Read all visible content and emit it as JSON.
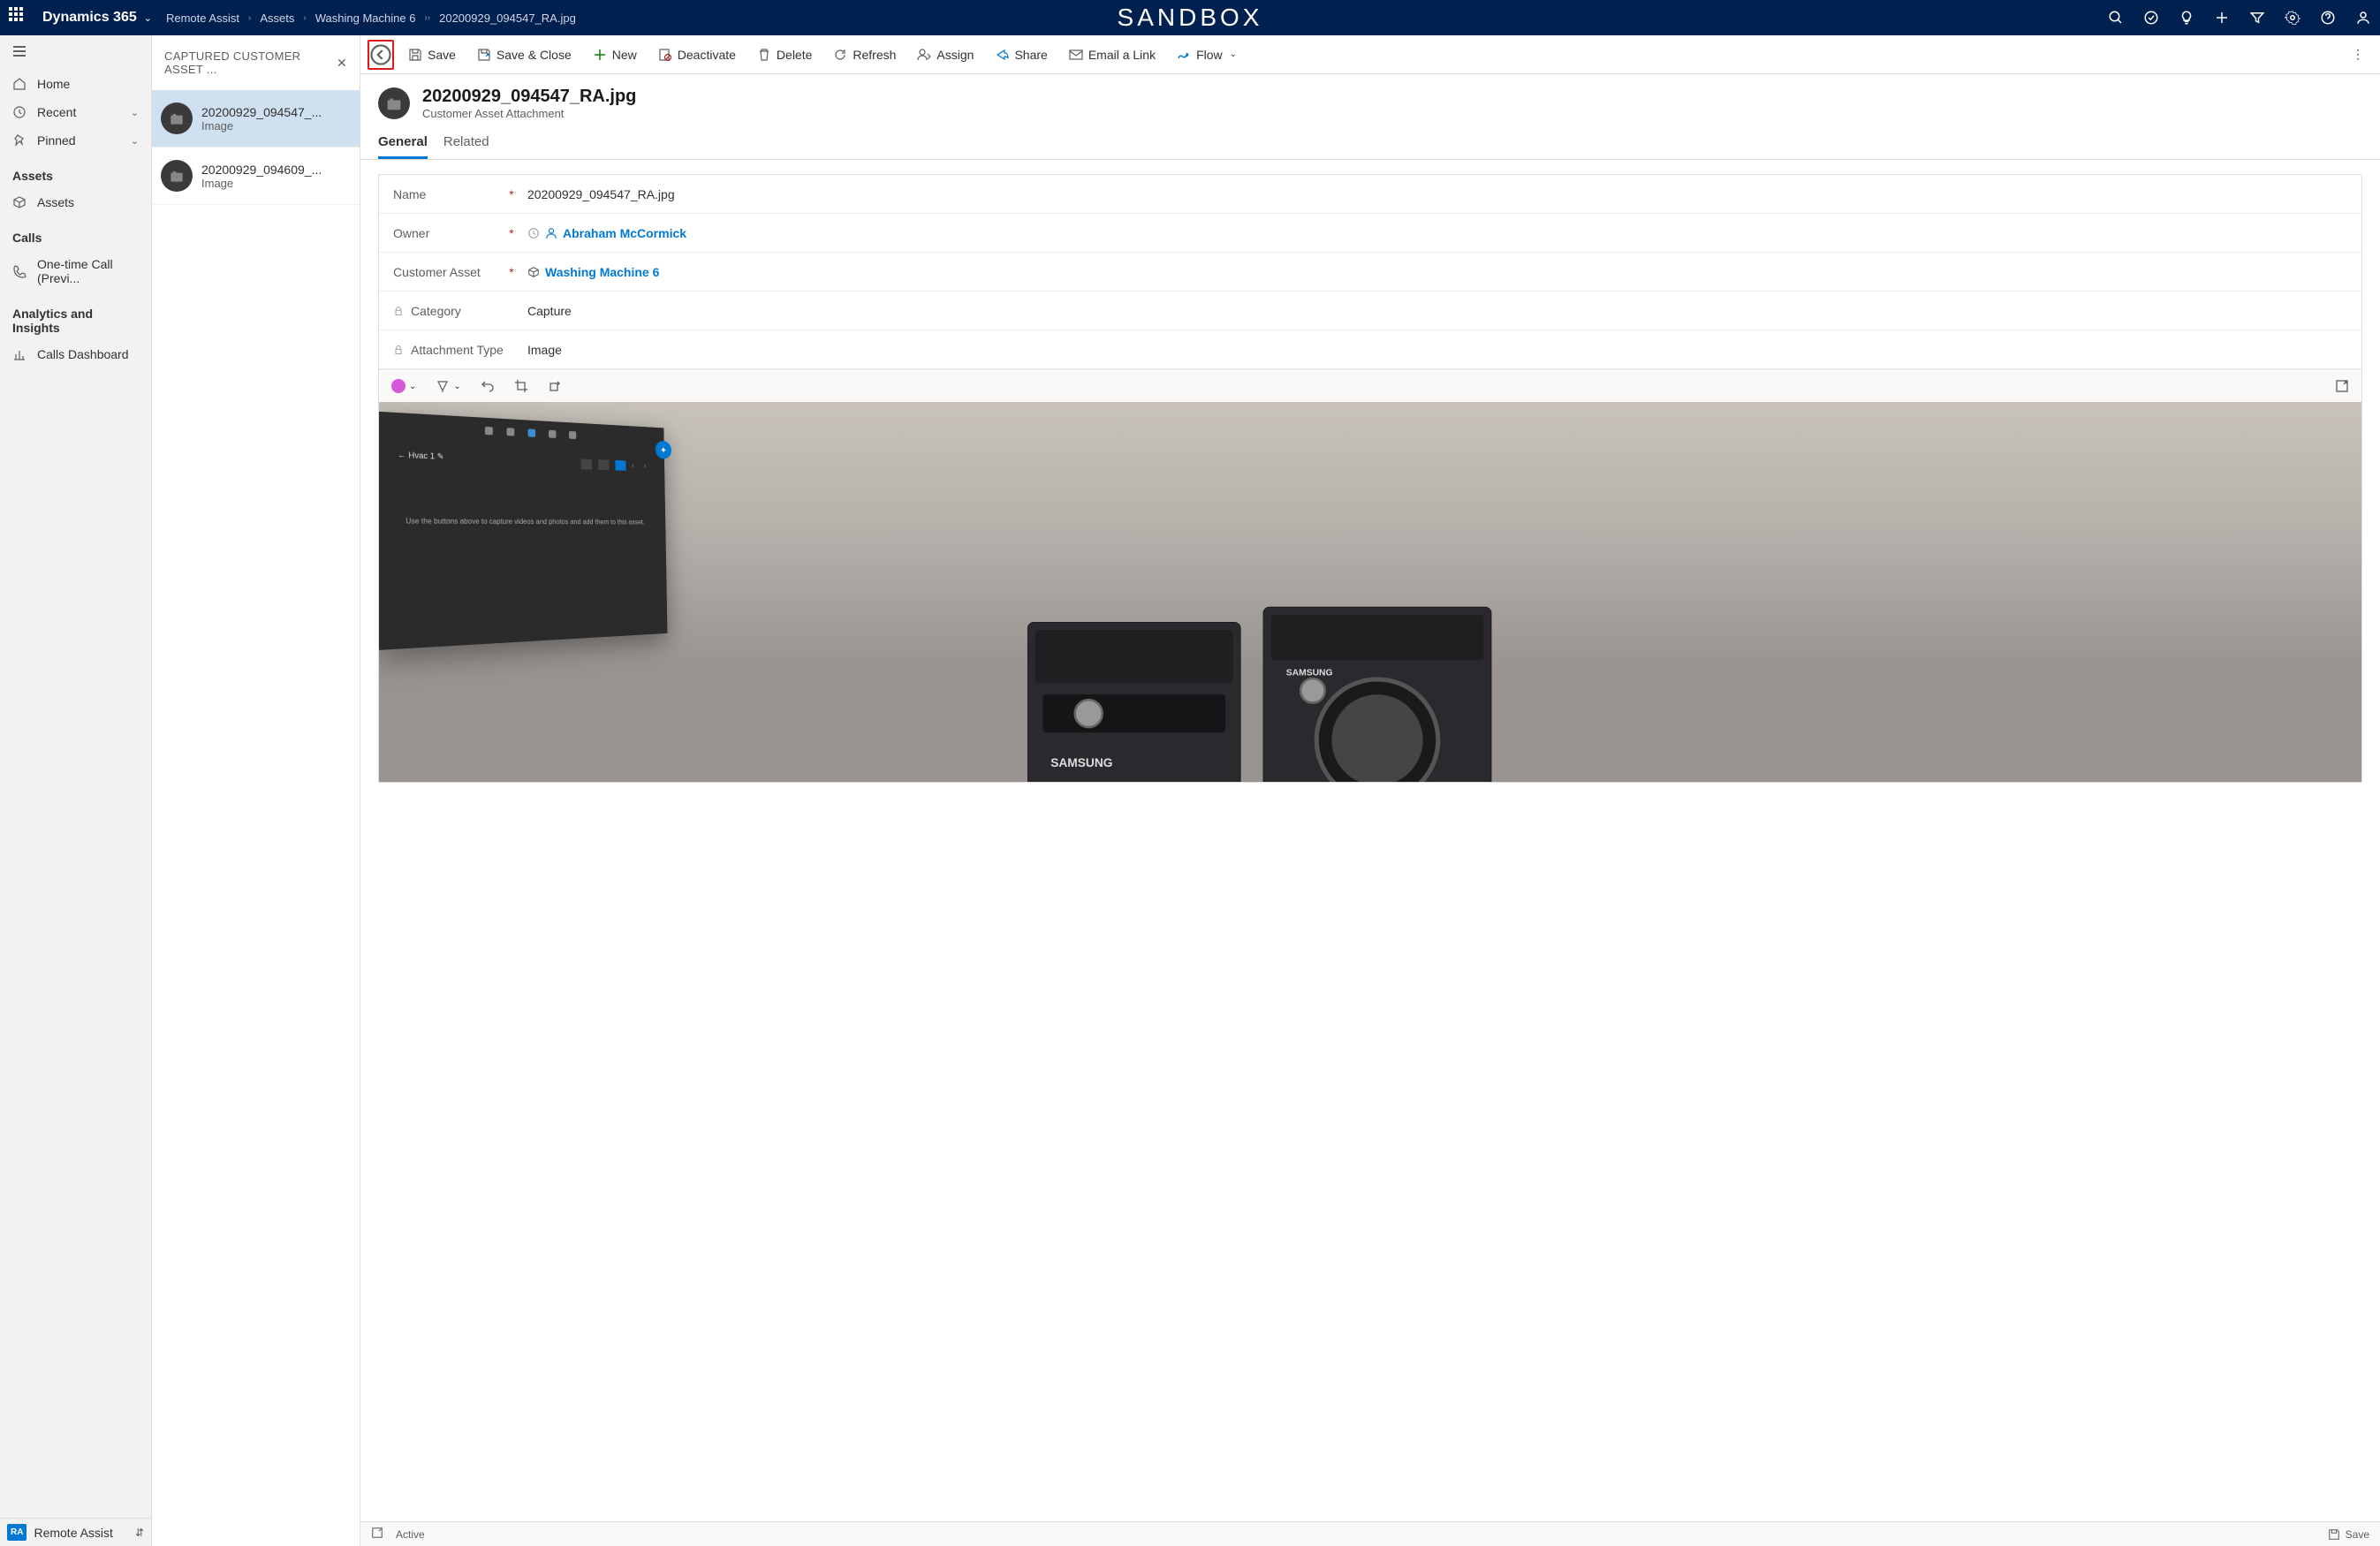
{
  "top": {
    "brand": "Dynamics 365",
    "app": "Remote Assist",
    "breadcrumb": [
      "Remote Assist",
      "Assets",
      "Washing Machine 6",
      "20200929_094547_RA.jpg"
    ],
    "watermark": "SANDBOX"
  },
  "nav": {
    "home": "Home",
    "recent": "Recent",
    "pinned": "Pinned",
    "groups": [
      {
        "label": "Assets",
        "items": [
          "Assets"
        ]
      },
      {
        "label": "Calls",
        "items": [
          "One-time Call (Previ..."
        ]
      },
      {
        "label": "Analytics and Insights",
        "items": [
          "Calls Dashboard"
        ]
      }
    ],
    "footer_badge": "RA",
    "footer_label": "Remote Assist"
  },
  "list": {
    "header": "CAPTURED CUSTOMER ASSET ...",
    "items": [
      {
        "title": "20200929_094547_...",
        "sub": "Image"
      },
      {
        "title": "20200929_094609_...",
        "sub": "Image"
      }
    ]
  },
  "cmd": {
    "save": "Save",
    "save_close": "Save & Close",
    "new": "New",
    "deactivate": "Deactivate",
    "delete": "Delete",
    "refresh": "Refresh",
    "assign": "Assign",
    "share": "Share",
    "email_link": "Email a Link",
    "flow": "Flow"
  },
  "record": {
    "title": "20200929_094547_RA.jpg",
    "subtitle": "Customer Asset Attachment",
    "tabs": [
      "General",
      "Related"
    ],
    "fields": {
      "name_label": "Name",
      "name_value": "20200929_094547_RA.jpg",
      "owner_label": "Owner",
      "owner_value": "Abraham McCormick",
      "asset_label": "Customer Asset",
      "asset_value": "Washing Machine 6",
      "category_label": "Category",
      "category_value": "Capture",
      "attach_label": "Attachment Type",
      "attach_value": "Image"
    },
    "hololens_tab": "← Hvac 1 ✎",
    "hololens_text": "Use the buttons above to capture videos and photos and add them to this asset."
  },
  "status": {
    "state": "Active",
    "save": "Save"
  }
}
